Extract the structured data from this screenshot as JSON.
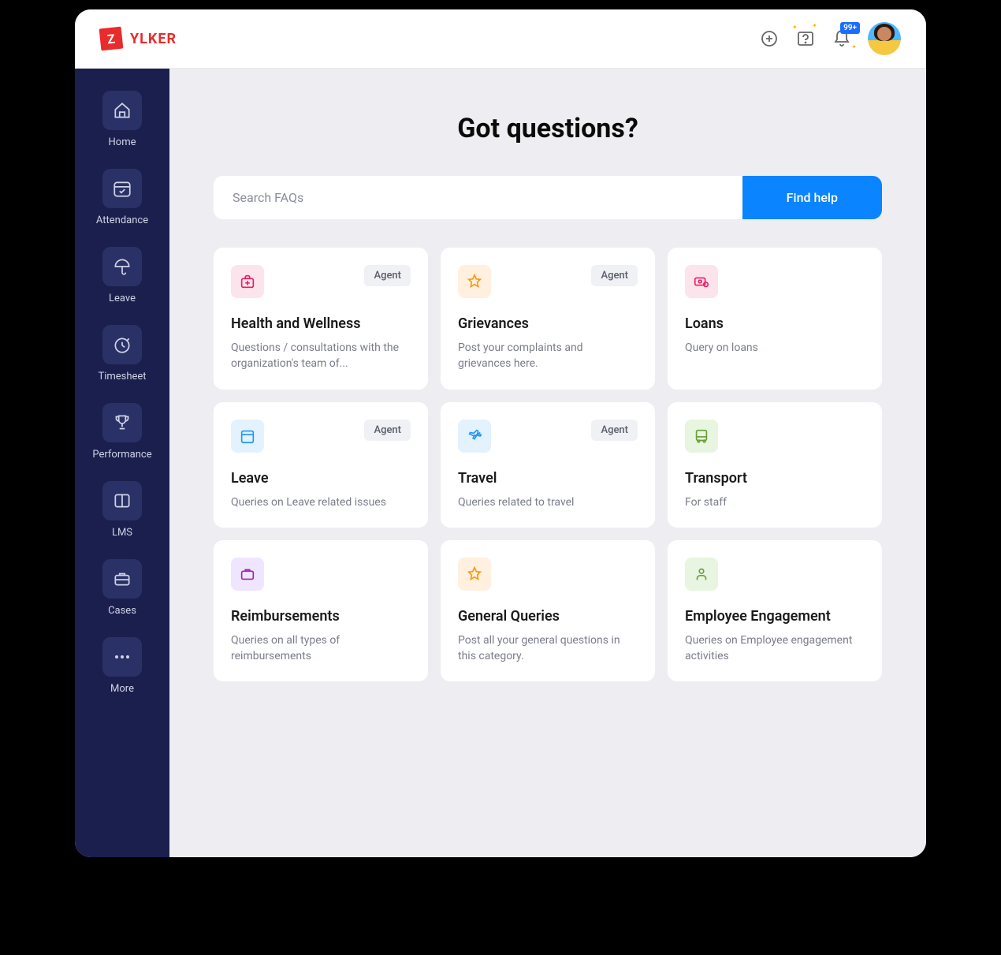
{
  "logo": {
    "mark": "Z",
    "text": "YLKER"
  },
  "header": {
    "notification_badge": "99+"
  },
  "sidebar": {
    "items": [
      {
        "id": "home",
        "label": "Home"
      },
      {
        "id": "attendance",
        "label": "Attendance"
      },
      {
        "id": "leave",
        "label": "Leave"
      },
      {
        "id": "timesheet",
        "label": "Timesheet"
      },
      {
        "id": "performance",
        "label": "Performance"
      },
      {
        "id": "lms",
        "label": "LMS"
      },
      {
        "id": "cases",
        "label": "Cases"
      },
      {
        "id": "more",
        "label": "More"
      }
    ]
  },
  "page": {
    "title": "Got questions?",
    "search_placeholder": "Search FAQs",
    "search_button": "Find help"
  },
  "badge": {
    "agent": "Agent"
  },
  "cards": [
    {
      "title": "Health and Wellness",
      "desc": "Questions / consultations with the organization's team of...",
      "agent": true,
      "icon": "medical-bag"
    },
    {
      "title": "Grievances",
      "desc": "Post your complaints and grievances here.",
      "agent": true,
      "icon": "star"
    },
    {
      "title": "Loans",
      "desc": "Query on loans",
      "agent": false,
      "icon": "money"
    },
    {
      "title": "Leave",
      "desc": "Queries on Leave related issues",
      "agent": true,
      "icon": "calendar"
    },
    {
      "title": "Travel",
      "desc": "Queries related to travel",
      "agent": true,
      "icon": "plane"
    },
    {
      "title": "Transport",
      "desc": "For staff",
      "agent": false,
      "icon": "bus"
    },
    {
      "title": "Reimbursements",
      "desc": "Queries on all types of reimbursements",
      "agent": false,
      "icon": "briefcase"
    },
    {
      "title": "General Queries",
      "desc": "Post all your general questions in this category.",
      "agent": false,
      "icon": "star"
    },
    {
      "title": "Employee Engagement",
      "desc": "Queries on Employee engagement activities",
      "agent": false,
      "icon": "person"
    }
  ]
}
